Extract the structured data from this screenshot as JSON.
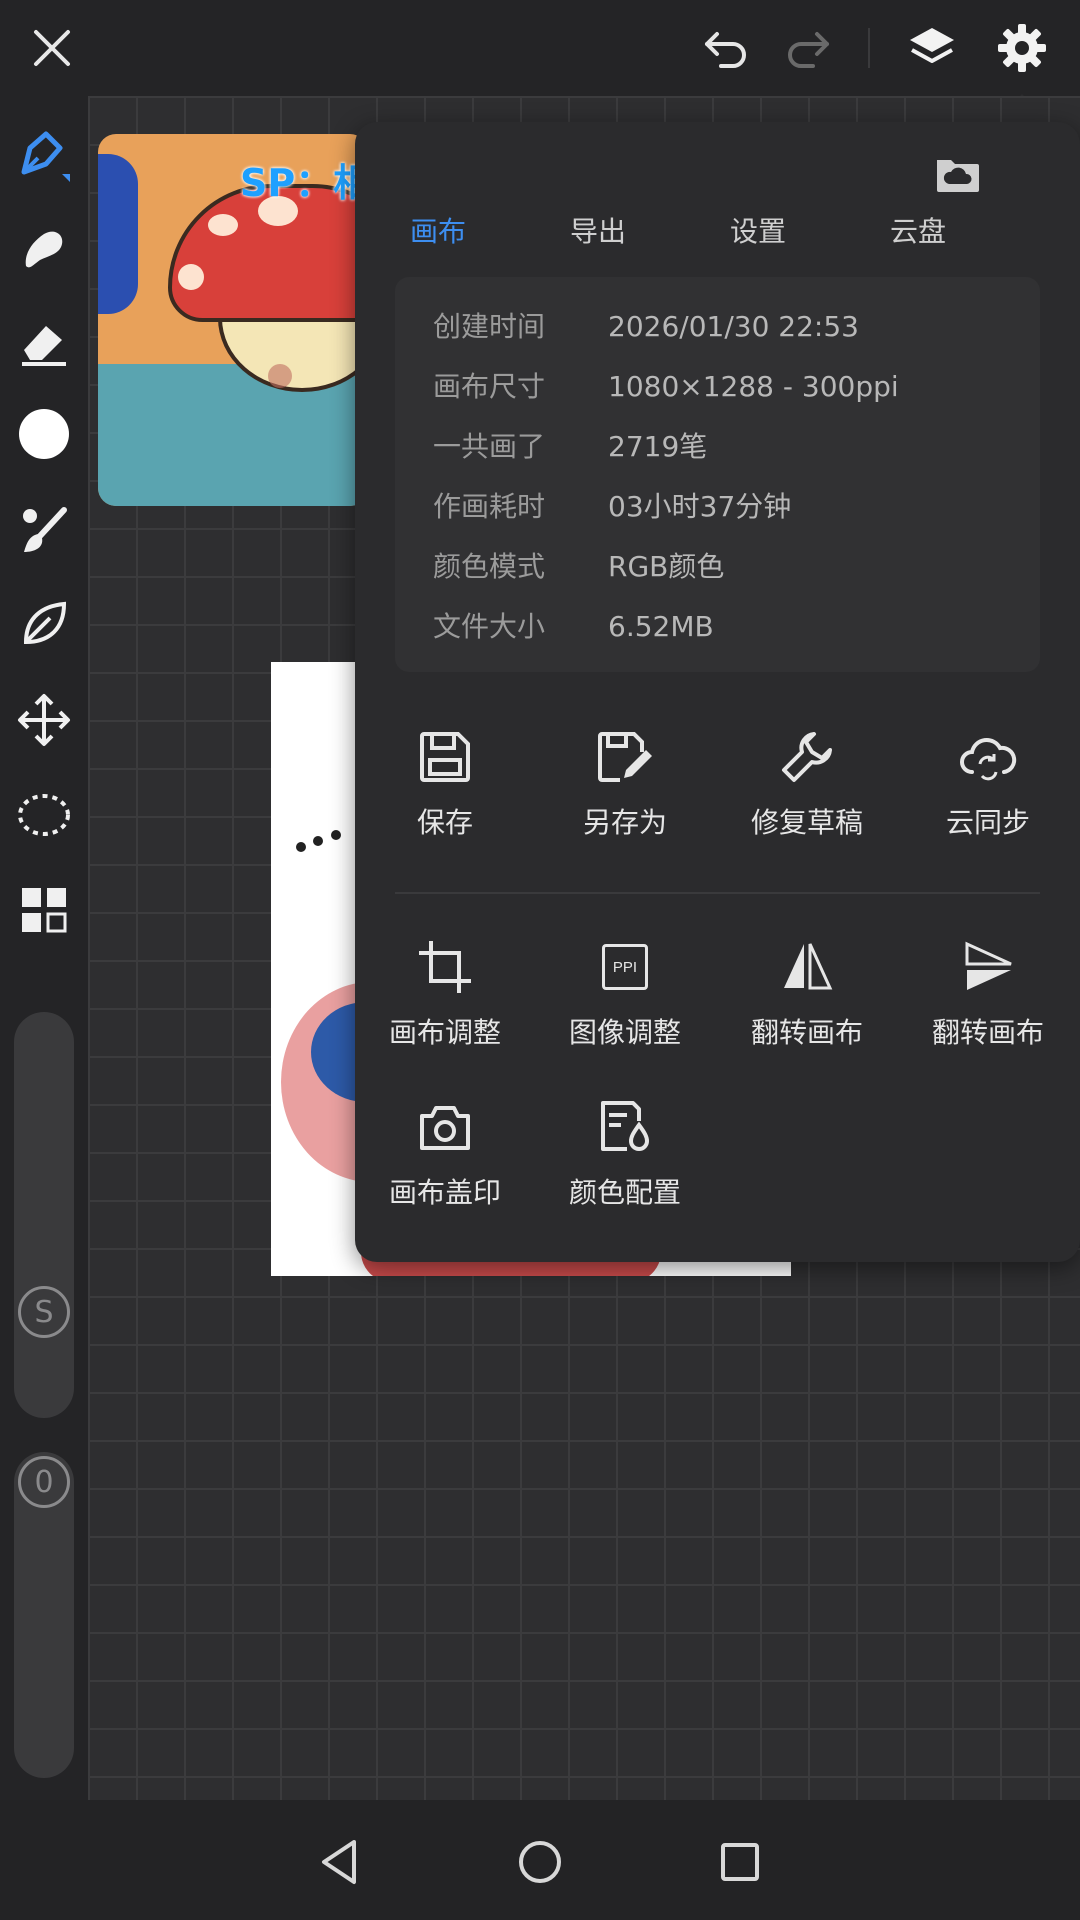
{
  "watermark": "SP：相信音乐国际股份有限公司",
  "panel": {
    "tabs": [
      {
        "label": "画布",
        "active": true
      },
      {
        "label": "导出",
        "active": false
      },
      {
        "label": "设置",
        "active": false
      },
      {
        "label": "云盘",
        "active": false
      }
    ],
    "info": [
      {
        "label": "创建时间",
        "value": "2026/01/30 22:53"
      },
      {
        "label": "画布尺寸",
        "value": "1080×1288 - 300ppi"
      },
      {
        "label": "一共画了",
        "value": "2719笔"
      },
      {
        "label": "作画耗时",
        "value": "03小时37分钟"
      },
      {
        "label": "颜色模式",
        "value": "RGB颜色"
      },
      {
        "label": "文件大小",
        "value": "6.52MB"
      }
    ],
    "actions_row1": [
      {
        "label": "保存",
        "icon": "save-icon"
      },
      {
        "label": "另存为",
        "icon": "save-as-icon"
      },
      {
        "label": "修复草稿",
        "icon": "wrench-icon"
      },
      {
        "label": "云同步",
        "icon": "cloud-sync-icon"
      }
    ],
    "actions_row2": [
      {
        "label": "画布调整",
        "icon": "crop-icon"
      },
      {
        "label": "图像调整",
        "icon": "ppi-icon",
        "badge": "PPI"
      },
      {
        "label": "翻转画布",
        "icon": "flip-horizontal-icon"
      },
      {
        "label": "翻转画布",
        "icon": "flip-vertical-icon"
      }
    ],
    "actions_row3": [
      {
        "label": "画布盖印",
        "icon": "camera-icon"
      },
      {
        "label": "颜色配置",
        "icon": "color-config-icon"
      }
    ]
  },
  "sliders": {
    "size_label": "S",
    "opacity_label": "0"
  },
  "colors": {
    "accent": "#3d8ef0",
    "current_color": "#ffffff",
    "watermark": "#1ea0ff"
  }
}
